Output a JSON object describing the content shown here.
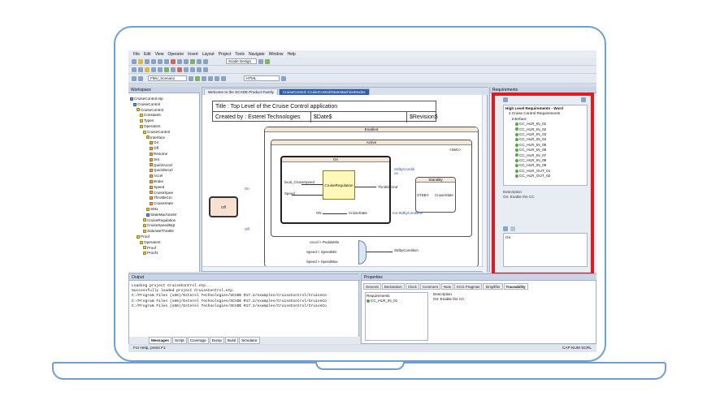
{
  "menu": [
    "File",
    "Edit",
    "View",
    "Operator",
    "Insert",
    "Layout",
    "Project",
    "Tools",
    "Navigate",
    "Window",
    "Help"
  ],
  "toolbar": {
    "design_combo": "Scade Design",
    "scenario_combo": "FMU_Scenario",
    "html_combo": "HTML"
  },
  "workspace": {
    "title": "Workspace",
    "items": [
      {
        "label": "CruiseControl.etp",
        "depth": 0,
        "kind": "b"
      },
      {
        "label": "CruiseControl",
        "depth": 1,
        "kind": "b"
      },
      {
        "label": "CruiseControl",
        "depth": 2,
        "kind": "y"
      },
      {
        "label": "Constants",
        "depth": 3,
        "kind": "y"
      },
      {
        "label": "Types",
        "depth": 3,
        "kind": "y"
      },
      {
        "label": "Operators",
        "depth": 3,
        "kind": "y"
      },
      {
        "label": "CruiseControl",
        "depth": 4,
        "kind": "y"
      },
      {
        "label": "Interface",
        "depth": 5,
        "kind": "y"
      },
      {
        "label": "On",
        "depth": 6,
        "kind": "o"
      },
      {
        "label": "Off",
        "depth": 6,
        "kind": "o"
      },
      {
        "label": "Resume",
        "depth": 6,
        "kind": "o"
      },
      {
        "label": "Set",
        "depth": 6,
        "kind": "o"
      },
      {
        "label": "QuickAccel",
        "depth": 6,
        "kind": "o"
      },
      {
        "label": "QuickDecel",
        "depth": 6,
        "kind": "o"
      },
      {
        "label": "Accel",
        "depth": 6,
        "kind": "o"
      },
      {
        "label": "Brake",
        "depth": 6,
        "kind": "o"
      },
      {
        "label": "Speed",
        "depth": 6,
        "kind": "o"
      },
      {
        "label": "CruiseSpee",
        "depth": 6,
        "kind": "o"
      },
      {
        "label": "ThrottleCm",
        "depth": 6,
        "kind": "o"
      },
      {
        "label": "CruiseState",
        "depth": 6,
        "kind": "o"
      },
      {
        "label": "SM1",
        "depth": 5,
        "kind": "y"
      },
      {
        "label": "StateMachineM",
        "depth": 5,
        "kind": "b"
      },
      {
        "label": "CruiseRegulation",
        "depth": 4,
        "kind": "y"
      },
      {
        "label": "CruiseSpeedMgt",
        "depth": 4,
        "kind": "y"
      },
      {
        "label": "SaturateThrottle",
        "depth": 4,
        "kind": "y"
      },
      {
        "label": "Proof",
        "depth": 2,
        "kind": "y"
      },
      {
        "label": "Operators",
        "depth": 3,
        "kind": "y"
      },
      {
        "label": "Proof",
        "depth": 4,
        "kind": "y"
      },
      {
        "label": "Proof1",
        "depth": 4,
        "kind": "y"
      }
    ],
    "tabs": [
      "FileView",
      "Scade",
      "Test View"
    ]
  },
  "editor": {
    "tabs": [
      "Welcome to the SCADE Product Family",
      "CruiseControl::CruiseControl/StateMachineModes"
    ],
    "title_cell": "Title : Top Level of the Cruise Control application",
    "created_cell": "Created by : Esterel Technologies",
    "date_cell": "$Date$",
    "revision_cell": "$Revision$",
    "enabled_label": "Enabled",
    "active_label": "Active",
    "on_label": "On",
    "off_label": "Off",
    "standby_label": "StandBy",
    "regulation_label": "CruiseRegulation",
    "cruise_state_label": "CruiseState",
    "local_speed_label": "local_CruiseSpeed",
    "speed_label": "Speed",
    "throttle_label": "ThrottleCmd",
    "stdby_label": "STDBY",
    "on_state_label": "ON",
    "cond_label": "StdbyConditi on",
    "not_cond_label": "not StdbyCondition",
    "accel_label": "Accel > PedalsMin",
    "speed_min_label": "Speed < SpeedMin",
    "speed_max_label": "Speed > SpeedMax",
    "stdby_cond2_label": "StdbyCondition",
    "on_trans": "On",
    "off_trans": "Off",
    "sm1_label": "<SM1>"
  },
  "requirements": {
    "title": "Requirements",
    "root": "High Level Requirements - Word",
    "doc": "2 Cruise Control Requirements",
    "folder": "Interface",
    "items": [
      "CC_HLR_IN_01",
      "CC_HLR_IN_02",
      "CC_HLR_IN_03",
      "CC_HLR_IN_04",
      "CC_HLR_IN_05",
      "CC_HLR_IN_06",
      "CC_HLR_IN_07",
      "CC_HLR_IN_08",
      "CC_HLR_IN_09",
      "CC_HLR_OUT_01",
      "CC_HLR_OUT_02"
    ],
    "desc_label": "Description",
    "desc_text": "On: Enable the CC",
    "linked": "On"
  },
  "output": {
    "title": "Output",
    "lines": [
      "Loading project CruiseControl.etp...",
      "Successfully loaded project CruiseControl.etp.",
      "C:/Program Files (x86)/Esterel Technologies/SCADE R17.2/examples/CruiseControl/CruiseCo",
      "C:/Program Files (x86)/Esterel Technologies/SCADE R17.2/examples/CruiseControl/CruiseCo",
      "C:/Program Files (x86)/Esterel Technologies/SCADE R17.2/examples/CruiseControl/CruiseCo"
    ],
    "tabs": [
      "Messages",
      "Script",
      "Coverage",
      "Dump",
      "Build",
      "Simulator"
    ]
  },
  "properties": {
    "title": "Properties",
    "tabs": [
      "General",
      "Declaration",
      "Clock",
      "Comment",
      "Note",
      "KCG Pragmas",
      "Simplifier",
      "Traceability"
    ],
    "req_header": "Requirements",
    "req_item": "CC_HLR_IN_01",
    "desc_header": "Description",
    "desc_text": "On: Enable the CC"
  },
  "status": {
    "left": "For Help, press F1",
    "right": "CAP  NUM  SCRL"
  }
}
